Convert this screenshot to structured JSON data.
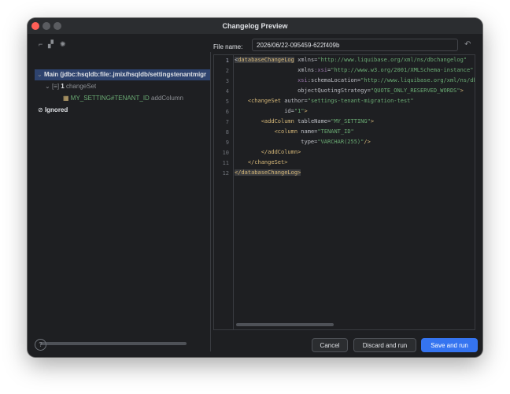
{
  "window": {
    "title": "Changelog Preview"
  },
  "toolbar": {
    "icons": [
      "expand-icon",
      "collapse-icon",
      "settings-icon"
    ]
  },
  "tree": {
    "root_label": "Main (jdbc:hsqldb:file:.jmix/hsqldb/settingstenantmigr",
    "changeset_count": "1",
    "changeset_label": "changeSet",
    "change_name": "MY_SETTING#TENANT_ID",
    "change_type": "addColumn",
    "ignored_label": "Ignored"
  },
  "file": {
    "label": "File name:",
    "value": "2026/06/22-095459-622f409b"
  },
  "editor": {
    "line_numbers": [
      "1",
      "2",
      "3",
      "4",
      "5",
      "6",
      "7",
      "8",
      "9",
      "10",
      "11",
      "12"
    ]
  },
  "buttons": {
    "cancel": "Cancel",
    "discard": "Discard and run",
    "save": "Save and run",
    "help": "?"
  },
  "colors": {
    "accent": "#3574f0",
    "selection": "#2e436e",
    "tag": "#d5b778",
    "string": "#6aab73"
  }
}
